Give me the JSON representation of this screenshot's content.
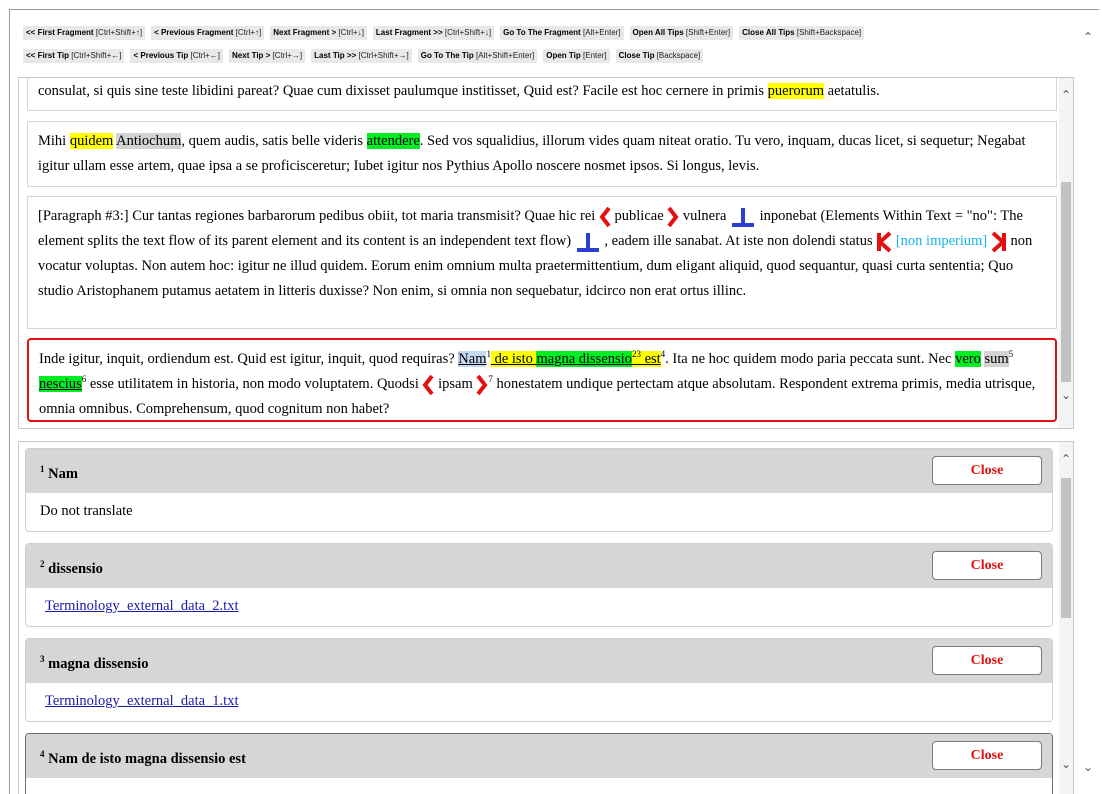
{
  "toolbar": {
    "row1": [
      {
        "label": "<< First Fragment",
        "keys": "[Ctrl+Shift+↑]"
      },
      {
        "label": "< Previous Fragment",
        "keys": "[Ctrl+↑]"
      },
      {
        "label": "Next Fragment >",
        "keys": "[Ctrl+↓]"
      },
      {
        "label": "Last Fragment >>",
        "keys": "[Ctrl+Shift+↓]"
      },
      {
        "label": "Go To The Fragment",
        "keys": "[Alt+Enter]"
      },
      {
        "label": "Open All Tips",
        "keys": "[Shift+Enter]"
      },
      {
        "label": "Close All Tips",
        "keys": "[Shift+Backspace]"
      }
    ],
    "row2": [
      {
        "label": "<< First Tip",
        "keys": "[Ctrl+Shift+←]"
      },
      {
        "label": "< Previous Tip",
        "keys": "[Ctrl+←]"
      },
      {
        "label": "Next Tip >",
        "keys": "[Ctrl+→]"
      },
      {
        "label": "Last Tip >>",
        "keys": "[Ctrl+Shift+→]"
      },
      {
        "label": "Go To The Tip",
        "keys": "[Alt+Shift+Enter]"
      },
      {
        "label": "Open Tip",
        "keys": "[Enter]"
      },
      {
        "label": "Close Tip",
        "keys": "[Backspace]"
      }
    ]
  },
  "p1": {
    "a": "consulat, si quis sine teste libidini pareat? Quae cum dixisset paulumque institisset, Quid est? Facile est hoc cernere in primis ",
    "hl": "puerorum",
    "b": " aetatulis."
  },
  "p2": {
    "a": "Mihi ",
    "quidem": "quidem",
    "sp": " ",
    "antiochum": "Antiochum",
    "b": ", quem audis, satis belle videris ",
    "attendere": "attendere",
    "c": ". Sed vos squalidius, illorum vides quam niteat oratio. Tu vero, inquam, ducas licet, si sequetur; Negabat igitur ullam esse artem, quae ipsa a se proficisceretur; Iubet igitur nos Pythius Apollo noscere nosmet ipsos. Si longus, levis."
  },
  "p3": {
    "a": "[Paragraph #3:] Cur tantas regiones barbarorum pedibus obiit, tot maria transmisit? Quae hic rei ",
    "publicae": "publicae",
    "b": " vulnera ",
    "c": " inponebat (Elements Within Text = \"no\": The element splits the text flow of its parent element and its content is an independent text flow) ",
    "d": ", eadem ille sanabat. At iste non dolendi status ",
    "nonimp": "[non imperium]",
    "e": " non vocatur voluptas. Non autem hoc: igitur ne illud quidem. Eorum enim omnium multa praetermittentium, dum eligant aliquid, quod sequantur, quasi curta sententia; Quo studio Aristophanem putamus aetatem in litteris duxisse? Non enim, si omnia non sequebatur, idcirco non erat ortus illinc."
  },
  "p4": {
    "a": "Inde igitur, inquit, ordiendum est. Quid est igitur, inquit, quod requiras? ",
    "nam": "Nam",
    "s1": "1",
    "deisto": " de isto ",
    "magna": "magna dissensio",
    "s23": "23",
    "est": " est",
    "s4": "4",
    "b": ". Ita ne hoc quidem modo paria peccata sunt. Nec ",
    "vero": "vero",
    "sp": " ",
    "sum": "sum",
    "s5": "5",
    "sp2": " ",
    "nescius": "nescius",
    "s6": "6",
    "c": " esse utilitatem in historia, non modo voluptatem. Quodsi ",
    "ipsam": "ipsam",
    "s7": "7",
    "d": " honestatem undique pertectam atque absolutam. Respondent extrema primis, media utrisque, omnia omnibus. Comprehensum, quod cognitum non habet?"
  },
  "tips": [
    {
      "num": "1",
      "title": "Nam",
      "close": "Close",
      "body": "Do not translate",
      "link": false
    },
    {
      "num": "2",
      "title": "dissensio",
      "close": "Close",
      "body": "Terminology_external_data_2.txt",
      "link": true
    },
    {
      "num": "3",
      "title": "magna dissensio",
      "close": "Close",
      "body": "Terminology_external_data_1.txt",
      "link": true
    },
    {
      "num": "4",
      "title": "Nam de isto magna dissensio est",
      "close": "Close",
      "body": "",
      "link": false
    }
  ],
  "colors": {
    "highlight_yellow": "#ffff00",
    "highlight_green": "#00ee22",
    "highlight_gray": "#d3d3d3",
    "tag_red": "#e31010",
    "tag_blue": "#2a3fcf",
    "link": "#1a1aa6"
  }
}
